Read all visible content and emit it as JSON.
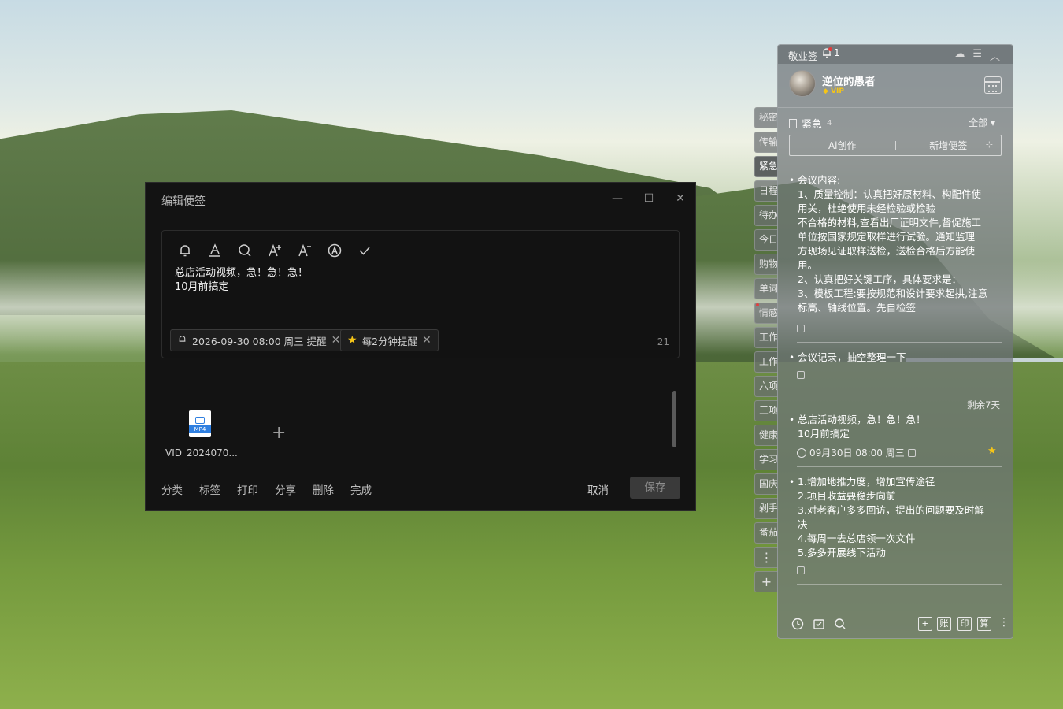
{
  "editor_dialog": {
    "title": "编辑便签",
    "minimize": "—",
    "maximize": "☐",
    "close": "✕",
    "content_line1": "总店活动视频，急！急！急！",
    "content_line2": "10月前搞定",
    "reminder_chip": "2026-09-30 08:00 周三 提醒",
    "repeat_chip": "每2分钟提醒",
    "char_count": "21",
    "attachment_name": "VID_2024070...",
    "attachment_type": "MP4",
    "add_symbol": "+",
    "footer": {
      "category": "分类",
      "tag": "标签",
      "print": "打印",
      "share": "分享",
      "delete": "删除",
      "done": "完成",
      "cancel": "取消",
      "save": "保存"
    },
    "toolbar_icons": [
      "bell-icon",
      "text-color-icon",
      "search-icon",
      "font-increase-icon",
      "font-decrease-icon",
      "text-style-icon",
      "check-icon"
    ]
  },
  "side_tabs": [
    "秘密",
    "传输",
    "紧急",
    "日程",
    "待办",
    "今日",
    "购物",
    "单词",
    "情感",
    "工作",
    "工作",
    "六项",
    "三项",
    "健康",
    "学习",
    "国庆",
    "剁手",
    "番茄"
  ],
  "side_tab_more": "⋮",
  "side_tab_add": "+",
  "panel": {
    "app_name": "敬业签",
    "notif_count": "1",
    "username": "逆位的愚者",
    "vip": "VIP",
    "category": "紧急",
    "category_count": "4",
    "filter": "全部 ▾",
    "ai_button": "Ai创作",
    "new_button": "新增便签",
    "notes": [
      {
        "lines": [
          "会议内容:",
          "1、质量控制：认真把好原材料、构配件使",
          "用关，杜绝使用未经检验或检验",
          "不合格的材料,查看出厂证明文件,督促施工",
          "单位按国家规定取样进行试验。通知监理",
          "方现场见证取样送检，送检合格后方能使",
          "用。",
          "2、认真把好关键工序，具体要求是：",
          "3、模板工程:要按规范和设计要求起拱,注意",
          "标高、轴线位置。先自检签"
        ]
      },
      {
        "lines": [
          "会议记录，抽空整理一下"
        ]
      },
      {
        "lines": [
          "总店活动视频，急！急！急！",
          "10月前搞定"
        ],
        "remaining": "剩余7天",
        "reminder": "09月30日 08:00 周三"
      },
      {
        "lines": [
          "1.增加地推力度，增加宣传途径",
          "2.项目收益要稳步向前",
          "3.对老客户多多回访，提出的问题要及时解",
          "决",
          "4.每周一去总店领一次文件",
          "5.多多开展线下活动"
        ]
      }
    ],
    "bottom_squares": [
      "+",
      "账",
      "印",
      "算"
    ],
    "bottom_more": "⋮"
  },
  "colors": {
    "dialog_bg": "#131313",
    "panel_bg": "#70767a",
    "accent_star": "#f5c518",
    "file_blue": "#2f7fe0"
  }
}
